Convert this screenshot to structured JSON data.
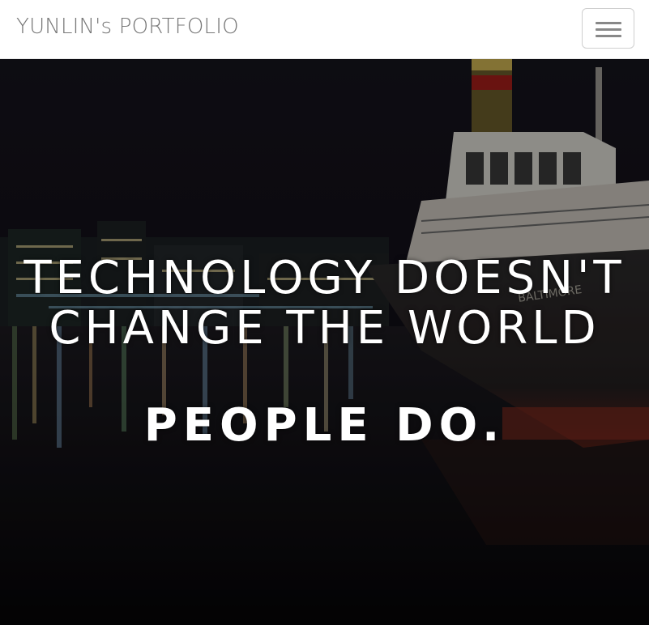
{
  "navbar": {
    "brand": "YUNLIN's PORTFOLIO",
    "toggle_icon": "hamburger-menu-icon"
  },
  "hero": {
    "headline_line1": "TECHNOLOGY DOESN'T",
    "headline_line2": "CHANGE THE WORLD",
    "subheadline": "PEOPLE DO.",
    "background_description_icon": "night-harbor-tugboat-image"
  },
  "colors": {
    "navbar_bg": "#ffffff",
    "brand_text": "#777777",
    "hero_text": "#ffffff",
    "hero_bg": "#0b0a12"
  }
}
